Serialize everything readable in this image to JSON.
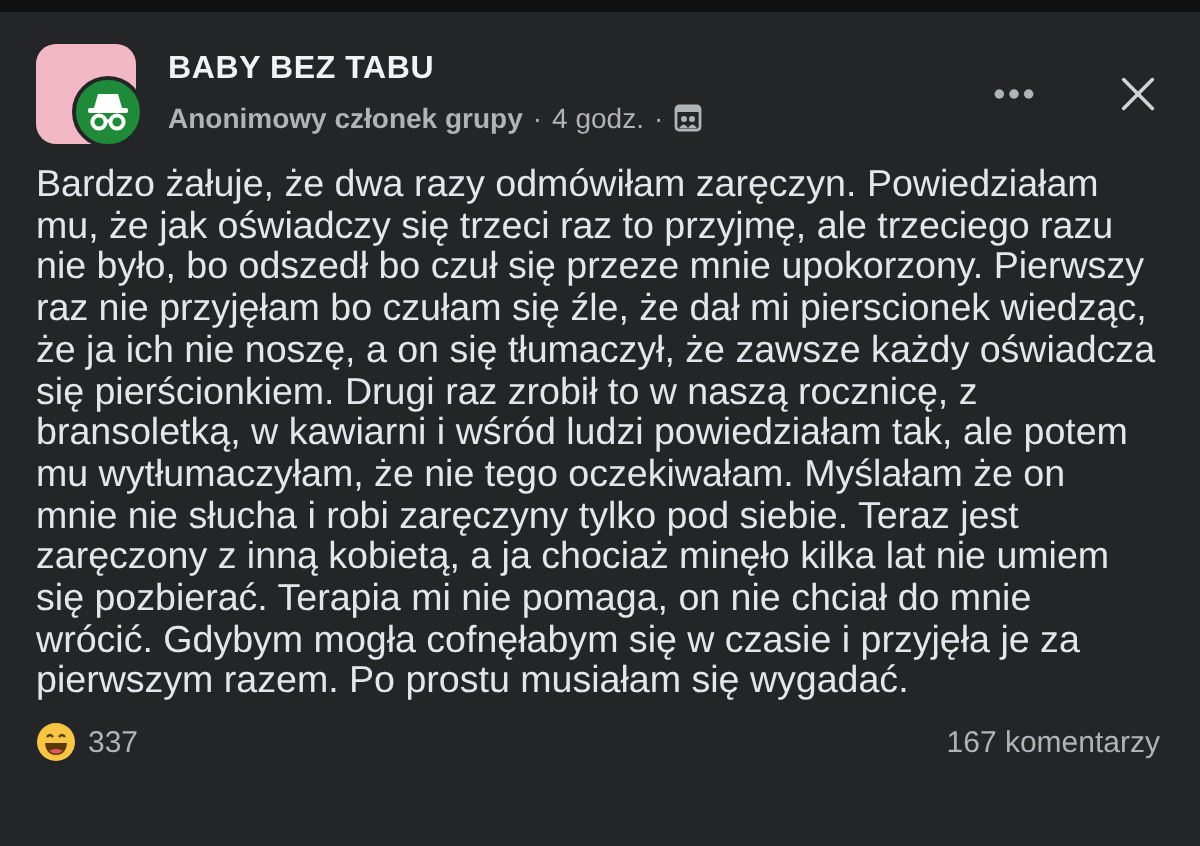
{
  "post": {
    "group": "BABY BEZ TABU",
    "author": "Anonimowy członek grupy",
    "time": "4 godz.",
    "separators": [
      "·",
      "·"
    ],
    "text": "Bardzo żałuje, że dwa razy odmówiłam zaręczyn. Powiedziałam\nmu, że jak oświadczy się trzeci raz to przyjmę, ale trzeciego razu\nnie było, bo odszedł bo czuł się przeze mnie upokorzony. Pierwszy\nraz nie przyjęłam bo czułam się źle, że dał mi pierscionek wiedząc,\nże ja ich nie noszę, a on się tłumaczył, że zawsze każdy oświadcza\nsię pierścionkiem. Drugi raz zrobił to w naszą rocznicę, z\nbransoletką, w kawiarni i wśród ludzi powiedziałam tak, ale potem\nmu wytłumaczyłam, że nie tego oczekiwałam. Myślałam że on\nmnie nie słucha i robi zaręczyny tylko pod siebie. Teraz jest\nzaręczony z inną kobietą, a ja chociaż minęło kilka lat nie umiem\nsię pozbierać. Terapia mi nie pomaga, on nie chciał do mnie\nwrócić. Gdybym mogła cofnęłabym się w czasie i przyjęła je za\npierwszym razem. Po prostu musiałam się wygadać.",
    "reactions": "337",
    "comments": "167 komentarzy"
  }
}
